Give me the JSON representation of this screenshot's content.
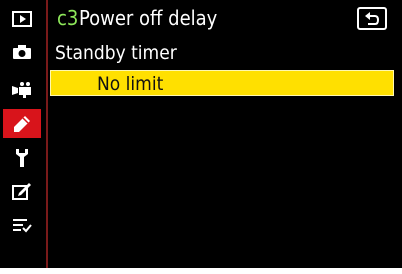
{
  "header": {
    "code": "c3",
    "title": "Power off delay",
    "back_icon": "return-icon"
  },
  "submenu": {
    "title": "Standby timer"
  },
  "options": [
    {
      "label": "No limit",
      "selected": true
    }
  ],
  "sidebar": {
    "tabs": [
      {
        "icon": "playback-icon",
        "selected": false
      },
      {
        "icon": "camera-icon",
        "selected": false
      },
      {
        "icon": "movie-camera-icon",
        "selected": false
      },
      {
        "icon": "pencil-icon",
        "selected": true
      },
      {
        "icon": "wrench-icon",
        "selected": false
      },
      {
        "icon": "retouch-icon",
        "selected": false
      },
      {
        "icon": "my-menu-icon",
        "selected": false
      }
    ]
  },
  "colors": {
    "background": "#000000",
    "selected_tab": "#d8141b",
    "highlight": "#ffe000",
    "code_text": "#8ee85a"
  }
}
